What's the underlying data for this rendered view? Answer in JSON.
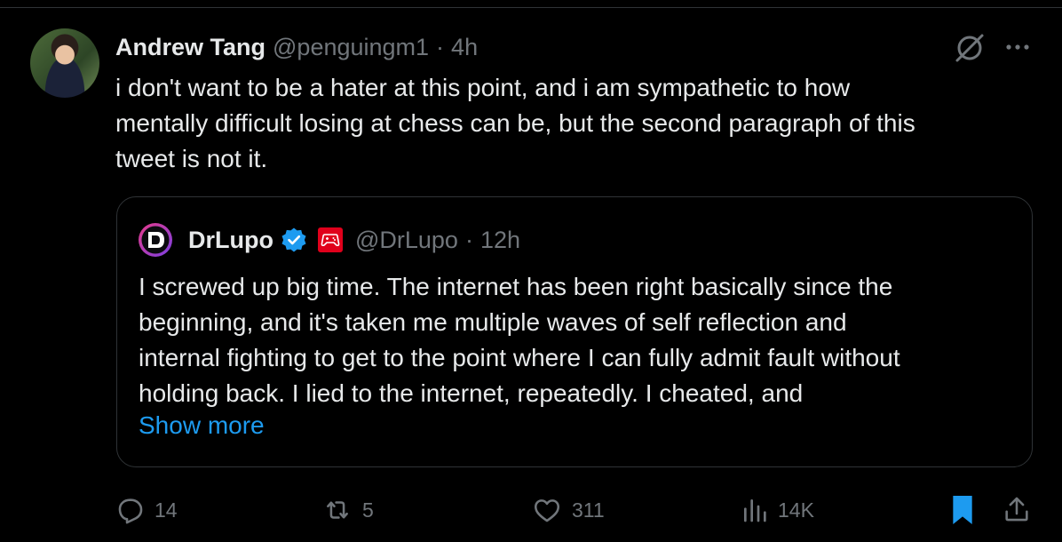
{
  "author": {
    "name": "Andrew Tang",
    "handle": "@penguingm1",
    "separator": "·",
    "time": "4h"
  },
  "tweet": {
    "text": "i don't want to be a hater at this point, and i am sympathetic to how\nmentally difficult losing at chess can be, but the second paragraph of this\ntweet is not it."
  },
  "quote": {
    "name": "DrLupo",
    "handle": "@DrLupo",
    "separator": "·",
    "time": "12h",
    "text": "I screwed up big time. The internet has been right basically since the\nbeginning, and it's taken me multiple waves of self reflection and\ninternal fighting to get to the point where I can fully admit fault without\nholding back. I lied to the internet, repeatedly. I cheated, and",
    "show_more": "Show more"
  },
  "actions": {
    "replies": "14",
    "reposts": "5",
    "likes": "311",
    "views": "14K"
  },
  "colors": {
    "background": "#000000",
    "text": "#e7e9ea",
    "muted": "#71767b",
    "accent": "#1d9bf0",
    "border": "#2f3336",
    "verified": "#1d9bf0"
  },
  "icons": [
    "grok-icon",
    "more-icon",
    "verified-badge-icon",
    "gaming-affiliate-icon",
    "reply-icon",
    "repost-icon",
    "like-icon",
    "views-icon",
    "bookmark-icon",
    "share-icon"
  ]
}
